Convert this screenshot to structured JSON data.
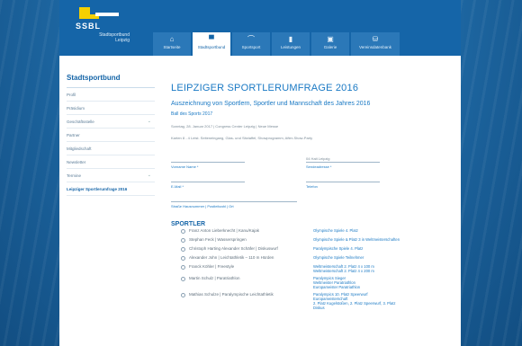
{
  "brand": {
    "name": "SSBL",
    "sub1": "Stadtsportbund",
    "sub2": "Leipzig"
  },
  "tabs": [
    {
      "label": "Startseite",
      "icon": "home-icon",
      "glyph": "⌂"
    },
    {
      "label": "Stadtsportbund",
      "icon": "logo-icon",
      "glyph": "▀"
    },
    {
      "label": "Sportsport",
      "icon": "whistle-icon",
      "glyph": "⌒"
    },
    {
      "label": "Leistungen",
      "icon": "document-icon",
      "glyph": "▮"
    },
    {
      "label": "Galerie",
      "icon": "image-icon",
      "glyph": "▣"
    },
    {
      "label": "Vereinsdatenbank",
      "icon": "database-icon",
      "glyph": "⛁"
    }
  ],
  "sidebar": {
    "title": "Stadtsportbund",
    "items": [
      {
        "label": "Profil"
      },
      {
        "label": "Präsidium"
      },
      {
        "label": "Geschäftsstelle",
        "chevron": "⌄"
      },
      {
        "label": "Partner"
      },
      {
        "label": "Mitgliedschaft"
      },
      {
        "label": "Newsletter"
      },
      {
        "label": "Termine",
        "chevron": "⌄"
      },
      {
        "label": "Leipziger Sportlerumfrage 2016",
        "active": true
      }
    ]
  },
  "main": {
    "title": "LEIPZIGER SPORTLERUMFRAGE 2016",
    "subtitle": "Auszeichnung von Sportlern, Sportler und Mannschaft des Jahres 2016",
    "ball_link": "Ball des Sports 2017",
    "date_line": "Sonntag, 28. Januar 2017 | Congress Center Leipzig | Neue Messe",
    "info_line": "Karten 8 - 4 Leist. Seiteneingang, Glas- und Sitztaffel, Showprogramm, After-Show-Party",
    "form": {
      "location_value": "04 Halt Leipzig",
      "name_label": "Vorname Name *",
      "location_label": "Sendeadresse *",
      "email_label": "E-Mail *",
      "phone_label": "Telefon",
      "agreement_label": "Straße Hausnummer | Postleitzahl | Ort"
    },
    "section_title": "SPORTLER",
    "athletes": [
      {
        "name": "Franz Anton Lieberknecht | Kanu/Kajak",
        "achievement": [
          "Olympische Spiele 4. Platz"
        ]
      },
      {
        "name": "Stephan Feck | Wasserspringen",
        "achievement": [
          "Olympische Spiele & Platz 3 in Weltmeisterschaften"
        ]
      },
      {
        "name": "Christoph Harting Alexander Schäfer | Diskuswurf",
        "achievement": [
          "Paralympische Spiele 4. Platz"
        ]
      },
      {
        "name": "Alexander John | Leichtathletik – 110 m Hürden",
        "achievement": [
          "Olympische Spiele Teilnehmer"
        ]
      },
      {
        "name": "Franck Köhler | Freestyle",
        "achievement": [
          "Weltmeisterschaft 2. Platz 4 x 100 m",
          "Weltmeisterschaft 2. Platz 4 x 200 m"
        ]
      },
      {
        "name": "Martin Schulz | Paratriathlon",
        "achievement": [
          "Paralympics Sieger",
          "Weltmeister Paratriathlon",
          "Europameister Paratriathlon"
        ]
      },
      {
        "name": "Mathias Schulze | Paralympische Leichtathletik",
        "achievement": [
          "Paralympics 10. Platz Speerwurf",
          "Europameisterschaft",
          "2. Platz Kugelstoßen, 2. Platz Speerwurf, 3. Platz",
          "Diskus"
        ]
      }
    ]
  }
}
